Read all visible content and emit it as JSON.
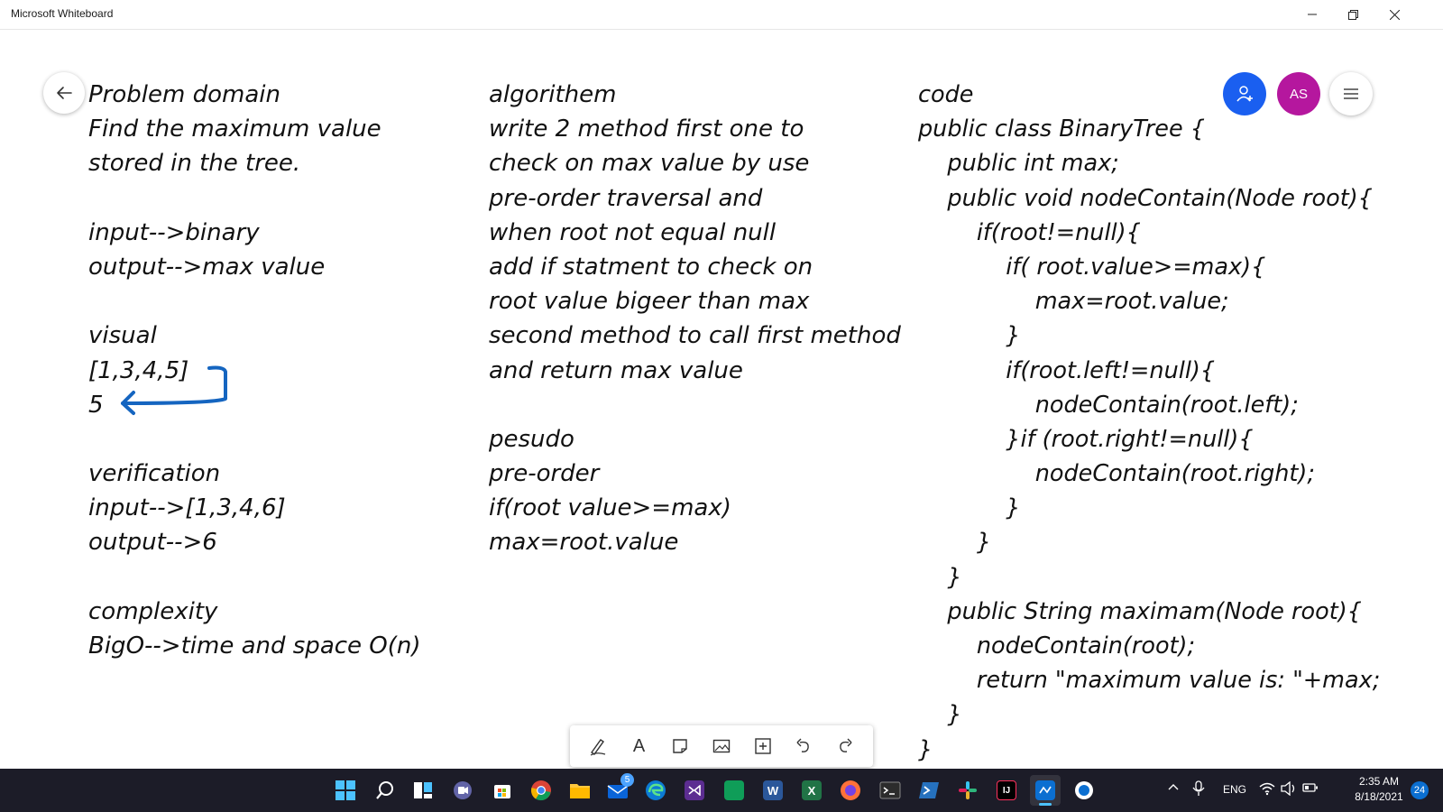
{
  "window": {
    "title": "Microsoft Whiteboard"
  },
  "user": {
    "initials": "AS"
  },
  "notes": {
    "col1": [
      "Problem domain",
      "Find the maximum value",
      "stored in the tree.",
      "",
      "input-->binary",
      "output-->max value",
      "",
      "visual",
      "[1,3,4,5]",
      "5",
      "",
      "verification",
      "input-->[1,3,4,6]",
      "output-->6",
      "",
      "complexity",
      "BigO-->time and space O(n)"
    ],
    "col2": [
      "algorithem",
      "write 2 method first one to",
      "check on max value by use",
      "pre-order traversal and",
      "when root not equal null",
      "add if statment to check on",
      "root value bigeer than max",
      "second method to call first method",
      "and return max value",
      "",
      "pesudo",
      "pre-order",
      "if(root value>=max)",
      "max=root.value"
    ],
    "col3": [
      "code",
      "public class BinaryTree {",
      "    public int max;",
      "    public void nodeContain(Node root){",
      "        if(root!=null){",
      "            if( root.value>=max){",
      "                max=root.value;",
      "            }",
      "            if(root.left!=null){",
      "                nodeContain(root.left);",
      "            }if (root.right!=null){",
      "                nodeContain(root.right);",
      "            }",
      "        }",
      "    }",
      "    public String maximam(Node root){",
      "        nodeContain(root);",
      "        return \"maximum value is: \"+max;",
      "    }",
      "}"
    ]
  },
  "toolbar": {
    "tools": [
      "pen-tool",
      "text-tool",
      "note-tool",
      "image-tool",
      "insert-tool",
      "undo",
      "redo"
    ],
    "text_glyph": "A"
  },
  "taskbar": {
    "mail_badge": "5",
    "language": "ENG",
    "time": "2:35 AM",
    "date": "8/18/2021",
    "notifications": "24"
  },
  "colors": {
    "invite_button": "#1a5ff0",
    "avatar": "#b5179e",
    "ink_arrow": "#1565c0",
    "taskbar": "#1c1c28"
  }
}
